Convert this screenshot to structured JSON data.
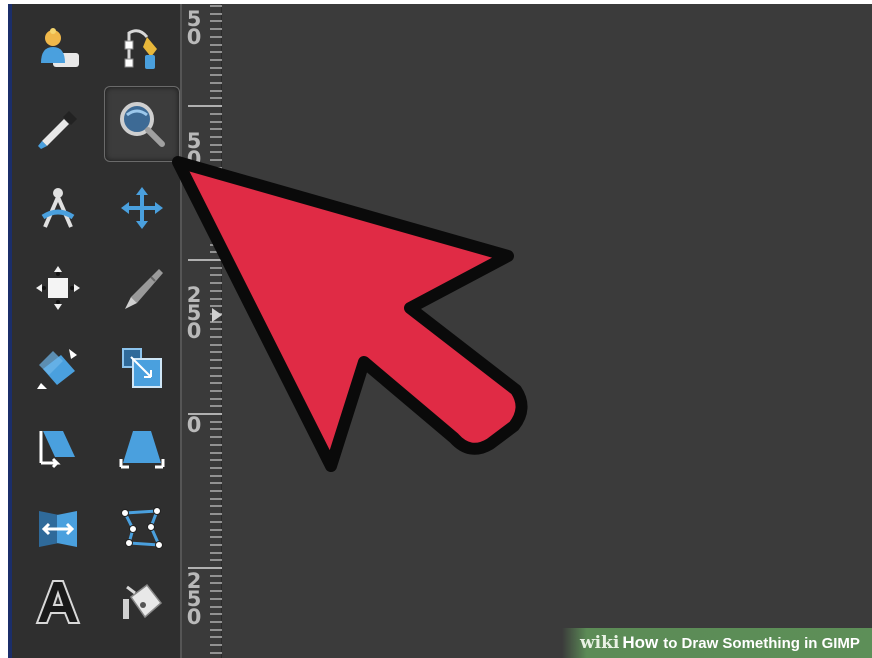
{
  "ruler": {
    "labels": [
      {
        "digits": [
          "5",
          "0"
        ]
      },
      {
        "digits": [
          "5",
          "0"
        ]
      },
      {
        "digits": [
          "2",
          "5",
          "0"
        ]
      },
      {
        "digits": [
          "0"
        ]
      },
      {
        "digits": [
          "2",
          "5",
          "0"
        ]
      }
    ]
  },
  "toolbox": {
    "tools": [
      {
        "name": "foreground-select-tool",
        "icon": "person-select-icon"
      },
      {
        "name": "paths-tool",
        "icon": "paths-pen-icon"
      },
      {
        "name": "color-picker-tool",
        "icon": "eyedropper-icon"
      },
      {
        "name": "zoom-tool",
        "icon": "magnifier-icon",
        "active": true
      },
      {
        "name": "measure-tool",
        "icon": "compass-icon"
      },
      {
        "name": "move-tool",
        "icon": "move-arrows-icon"
      },
      {
        "name": "alignment-tool",
        "icon": "align-icon"
      },
      {
        "name": "crop-tool",
        "icon": "knife-icon"
      },
      {
        "name": "rotate-tool",
        "icon": "rotate-icon"
      },
      {
        "name": "scale-tool",
        "icon": "scale-icon"
      },
      {
        "name": "shear-tool",
        "icon": "shear-icon"
      },
      {
        "name": "perspective-tool",
        "icon": "perspective-icon"
      },
      {
        "name": "flip-tool",
        "icon": "flip-icon"
      },
      {
        "name": "cage-transform-tool",
        "icon": "cage-icon"
      },
      {
        "name": "text-tool",
        "icon": "text-a-icon"
      },
      {
        "name": "bucket-fill-tool",
        "icon": "bucket-icon"
      }
    ]
  },
  "colors": {
    "arrow_fill": "#e02b45",
    "arrow_stroke": "#0a0a0a",
    "icon_blue": "#4aa0de",
    "watermark_green": "#6a9f5e"
  },
  "watermark": {
    "wiki": "wiki",
    "how": "How",
    "rest": "to Draw Something in GIMP"
  }
}
